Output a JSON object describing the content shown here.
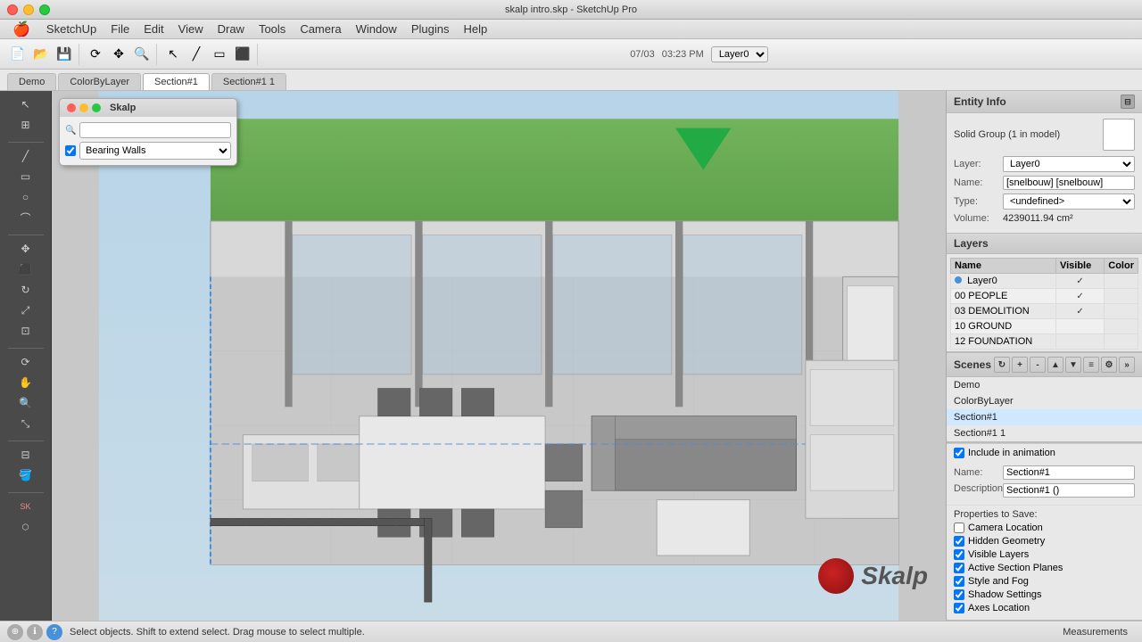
{
  "titlebar": {
    "title": "skalp intro.skp - SketchUp Pro",
    "close_btn": "●",
    "min_btn": "●",
    "max_btn": "●"
  },
  "menubar": {
    "apple": "🍎",
    "items": [
      "SketchUp",
      "File",
      "Edit",
      "View",
      "Draw",
      "Tools",
      "Camera",
      "Window",
      "Plugins",
      "Help"
    ]
  },
  "toolbar": {
    "date": "07/03",
    "time": "03:23 PM",
    "layer_label": "Layer0"
  },
  "tabs": {
    "items": [
      "Demo",
      "ColorByLayer",
      "Section#1",
      "Section#1 1"
    ],
    "active": "Section#1"
  },
  "skalp_panel": {
    "title": "Skalp",
    "search_placeholder": "",
    "dropdown_label": "Bearing Walls"
  },
  "entity_info": {
    "title": "Entity Info",
    "solid_group": "Solid Group (1 in model)",
    "layer_label": "Layer:",
    "layer_value": "Layer0",
    "name_label": "Name:",
    "name_value": "[snelbouw] [snelbouw]",
    "type_label": "Type:",
    "type_value": "<undefined>",
    "volume_label": "Volume:",
    "volume_value": "4239011.94 cm²"
  },
  "layers": {
    "title": "Layers",
    "columns": [
      "Name",
      "Visible",
      "Color"
    ],
    "rows": [
      {
        "name": "Layer0",
        "visible": true,
        "active": true
      },
      {
        "name": "00 PEOPLE",
        "visible": true,
        "active": false
      },
      {
        "name": "03 DEMOLITION",
        "visible": true,
        "active": false
      },
      {
        "name": "10 GROUND",
        "visible": false,
        "active": false
      },
      {
        "name": "12 FOUNDATION",
        "visible": false,
        "active": false
      }
    ]
  },
  "scenes": {
    "title": "Scenes",
    "items": [
      "Demo",
      "ColorByLayer",
      "Section#1",
      "Section#1 1"
    ],
    "active": "Section#1"
  },
  "scene_properties": {
    "include_animation": "Include in animation",
    "include_animation_checked": true,
    "name_label": "Name:",
    "name_value": "Section#1",
    "description_label": "Description:",
    "description_value": "Section#1 ()",
    "properties_label": "Properties to",
    "save_label": "Save:",
    "camera_location": "Camera Location",
    "camera_checked": false,
    "hidden_geometry": "Hidden Geometry",
    "hidden_checked": true,
    "visible_layers": "Visible Layers",
    "visible_checked": true,
    "active_section": "Active Section Planes",
    "active_checked": true,
    "style_fog": "Style and Fog",
    "style_checked": true,
    "shadow_settings": "Shadow Settings",
    "shadow_checked": true,
    "axes_location": "Axes Location",
    "axes_checked": true
  },
  "statusbar": {
    "text": "Select objects. Shift to extend select. Drag mouse to select multiple.",
    "measurements": "Measurements"
  }
}
